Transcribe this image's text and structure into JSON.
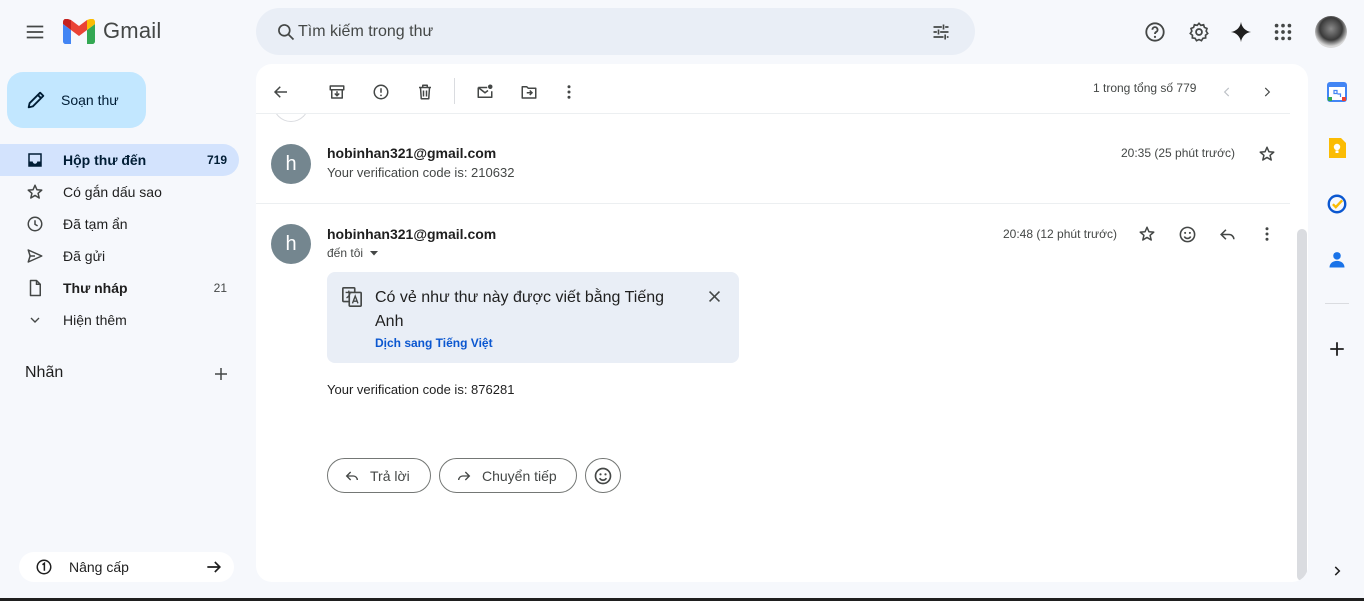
{
  "header": {
    "app_name": "Gmail",
    "search_placeholder": "Tìm kiếm trong thư",
    "icons": [
      "menu-icon",
      "gmail-logo",
      "search-icon",
      "filter-icon",
      "help-icon",
      "gear-icon",
      "gemini-icon",
      "apps-icon",
      "avatar"
    ]
  },
  "sidebar": {
    "compose_label": "Soạn thư",
    "items": [
      {
        "label": "Hộp thư đến",
        "count": "719",
        "icon": "inbox-icon",
        "active": true
      },
      {
        "label": "Có gắn dấu sao",
        "count": "",
        "icon": "star-icon"
      },
      {
        "label": "Đã tạm ẩn",
        "count": "",
        "icon": "clock-icon"
      },
      {
        "label": "Đã gửi",
        "count": "",
        "icon": "send-icon"
      },
      {
        "label": "Thư nháp",
        "count": "21",
        "icon": "draft-icon"
      },
      {
        "label": "Hiện thêm",
        "count": "",
        "icon": "chevron-down-icon"
      }
    ],
    "labels_title": "Nhãn",
    "upgrade_label": "Nâng cấp"
  },
  "toolbar": {
    "pager_text": "1 trong tổng số 779",
    "icons": [
      "back-arrow-icon",
      "archive-icon",
      "report-spam-icon",
      "delete-icon",
      "mark-unread-icon",
      "move-to-icon",
      "more-vert-icon",
      "prev-icon",
      "next-icon"
    ]
  },
  "messages": [
    {
      "avatar_letter": "h",
      "sender": "hobinhan321@gmail.com",
      "snippet": "Your verification code is: 210632",
      "time": "20:35 (25 phút trước)"
    },
    {
      "avatar_letter": "h",
      "sender": "hobinhan321@gmail.com",
      "to_label": "đến tôi",
      "time": "20:48 (12 phút trước)",
      "translate_text": "Có vẻ như thư này được viết bằng Tiếng Anh",
      "translate_link": "Dịch sang Tiếng Việt",
      "body": "Your verification code is: 876281"
    }
  ],
  "actions": {
    "reply_label": "Trả lời",
    "forward_label": "Chuyển tiếp"
  },
  "colors": {
    "background": "#f6f8fc",
    "compose_bg": "#c2e7ff",
    "active_nav": "#d3e3fd",
    "link_blue": "#0b57d0",
    "avatar_gray": "#74868f"
  }
}
